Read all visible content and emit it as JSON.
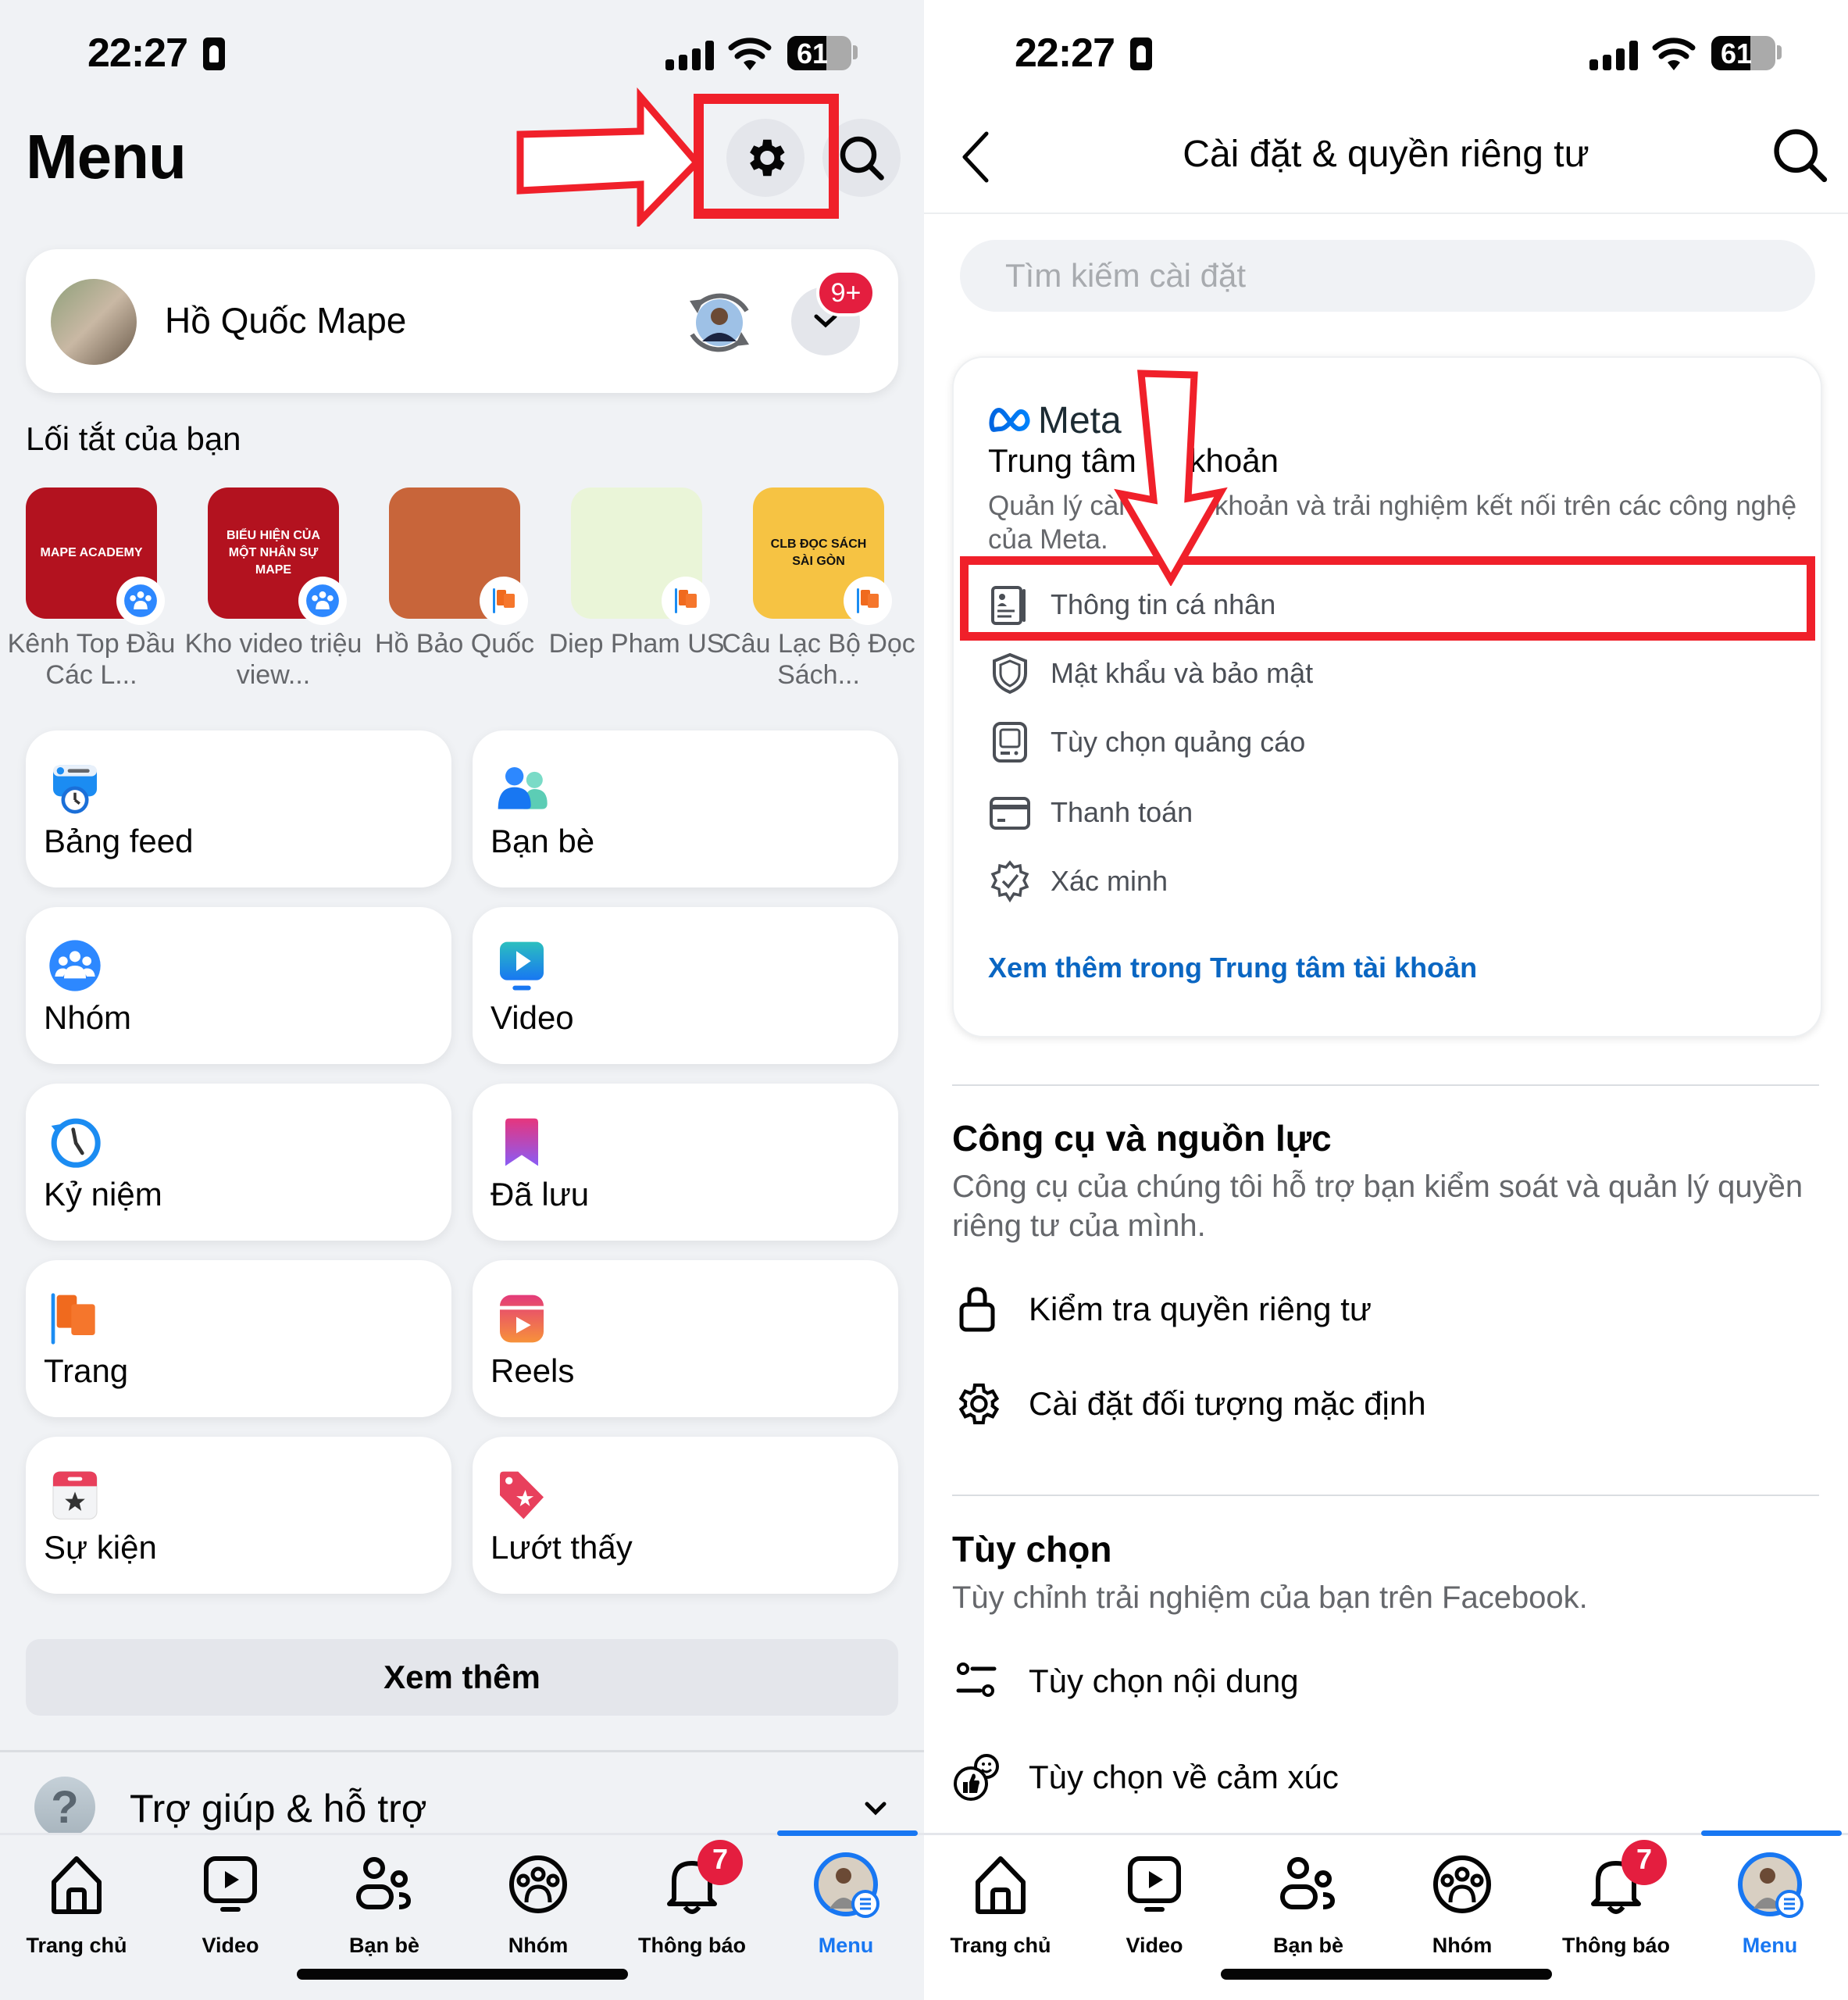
{
  "status_bar": {
    "time": "22:27",
    "battery": "61"
  },
  "left": {
    "title": "Menu",
    "profile": {
      "name": "Hồ Quốc Mape",
      "notification_badge": "9+"
    },
    "shortcuts_label": "Lối tắt của bạn",
    "shortcuts": [
      {
        "label": "Kênh Top Đầu Các L...",
        "type": "group",
        "thumb_color": "#b3121f",
        "thumb_text": "MAPE ACADEMY"
      },
      {
        "label": "Kho video triệu view...",
        "type": "group",
        "thumb_color": "#b3121f",
        "thumb_text": "BIỂU HIỆN CỦA MỘT NHÂN SỰ MAPE"
      },
      {
        "label": "Hồ Bảo Quốc",
        "type": "page",
        "thumb_color": "#c8653a",
        "thumb_text": ""
      },
      {
        "label": "Diep Pham US",
        "type": "page",
        "thumb_color": "#eaf5d8",
        "thumb_text": ""
      },
      {
        "label": "Câu Lạc Bộ Đọc Sách...",
        "type": "page",
        "thumb_color": "#f6c343",
        "thumb_text": "CLB ĐỌC SÁCH SÀI GÒN"
      }
    ],
    "tiles": [
      {
        "label": "Bảng feed",
        "icon": "feed-icon"
      },
      {
        "label": "Bạn bè",
        "icon": "friends-icon"
      },
      {
        "label": "Nhóm",
        "icon": "groups-icon"
      },
      {
        "label": "Video",
        "icon": "video-icon"
      },
      {
        "label": "Kỷ niệm",
        "icon": "memories-icon"
      },
      {
        "label": "Đã lưu",
        "icon": "saved-icon"
      },
      {
        "label": "Trang",
        "icon": "pages-flag-icon"
      },
      {
        "label": "Reels",
        "icon": "reels-icon"
      },
      {
        "label": "Sự kiện",
        "icon": "events-icon"
      },
      {
        "label": "Lướt thấy",
        "icon": "feeds-tag-icon"
      }
    ],
    "see_more": "Xem thêm",
    "help": "Trợ giúp & hỗ trợ"
  },
  "right": {
    "title": "Cài đặt & quyền riêng tư",
    "search_placeholder": "Tìm kiếm cài đặt",
    "accounts_center": {
      "brand": "Meta",
      "title": "Trung tâm tài khoản",
      "description": "Quản lý cài đặt tài khoản và trải nghiệm kết nối trên các công nghệ của Meta.",
      "items": [
        {
          "label": "Thông tin cá nhân",
          "icon": "id-card-icon",
          "highlighted": true
        },
        {
          "label": "Mật khẩu và bảo mật",
          "icon": "shield-icon"
        },
        {
          "label": "Tùy chọn quảng cáo",
          "icon": "ad-device-icon"
        },
        {
          "label": "Thanh toán",
          "icon": "credit-card-icon"
        },
        {
          "label": "Xác minh",
          "icon": "verified-badge-icon"
        }
      ],
      "link": "Xem thêm trong Trung tâm tài khoản"
    },
    "tools": {
      "title": "Công cụ và nguồn lực",
      "description": "Công cụ của chúng tôi hỗ trợ bạn kiểm soát và quản lý quyền riêng tư của mình.",
      "items": [
        {
          "label": "Kiểm tra quyền riêng tư",
          "icon": "lock-icon"
        },
        {
          "label": "Cài đặt đối tượng mặc định",
          "icon": "gear-icon"
        }
      ]
    },
    "preferences": {
      "title": "Tùy chọn",
      "description": "Tùy chỉnh trải nghiệm của bạn trên Facebook.",
      "items": [
        {
          "label": "Tùy chọn nội dung",
          "icon": "sliders-icon"
        },
        {
          "label": "Tùy chọn về cảm xúc",
          "icon": "reactions-icon"
        }
      ]
    }
  },
  "bottom_nav": {
    "items": [
      {
        "label": "Trang chủ",
        "icon": "home-icon"
      },
      {
        "label": "Video",
        "icon": "video-tv-icon"
      },
      {
        "label": "Bạn bè",
        "icon": "friends-outline-icon"
      },
      {
        "label": "Nhóm",
        "icon": "groups-outline-icon"
      },
      {
        "label": "Thông báo",
        "icon": "bell-icon",
        "badge": "7"
      },
      {
        "label": "Menu",
        "icon": "profile-menu-icon",
        "active": true
      }
    ]
  },
  "colors": {
    "accent": "#1877f2",
    "badge": "#e41e3f",
    "annotation": "#f0202a",
    "link": "#0a66c2"
  }
}
